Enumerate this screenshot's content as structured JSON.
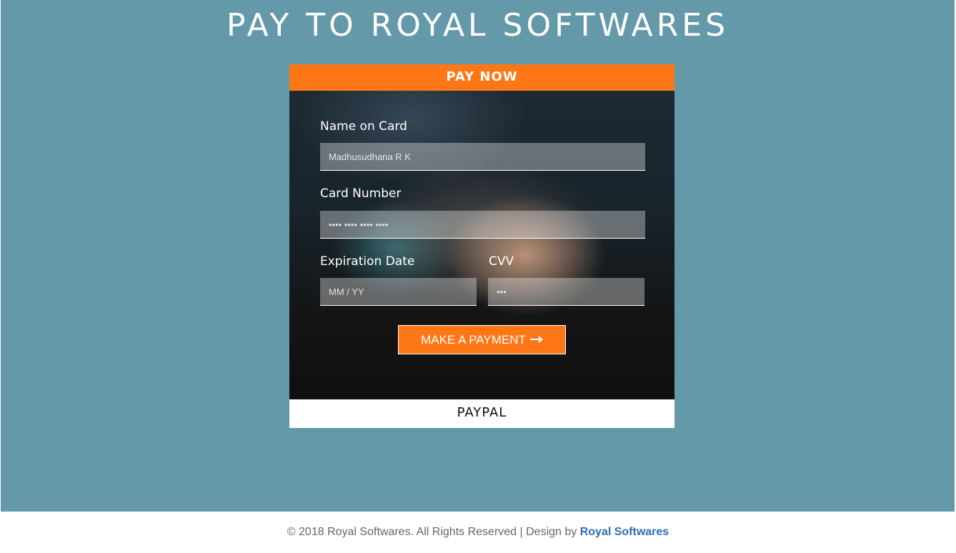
{
  "page": {
    "title": "PAY TO ROYAL SOFTWARES"
  },
  "card": {
    "header": "PAY NOW",
    "name_label": "Name on Card",
    "name_value": "Madhusudhana R K",
    "number_label": "Card Number",
    "number_placeholder": "•••• •••• •••• ••••",
    "expiry_label": "Expiration Date",
    "expiry_placeholder": "MM / YY",
    "cvv_label": "CVV",
    "cvv_placeholder": "•••",
    "submit_label": "MAKE A PAYMENT",
    "submit_icon": "arrow-right-icon",
    "footer": "PAYPAL"
  },
  "colors": {
    "background": "#6399a9",
    "accent": "#fd7717",
    "link": "#2b6fb3"
  },
  "footer": {
    "copyright": "© 2018 Royal Softwares. All Rights Reserved | Design by ",
    "link_text": "Royal Softwares"
  }
}
